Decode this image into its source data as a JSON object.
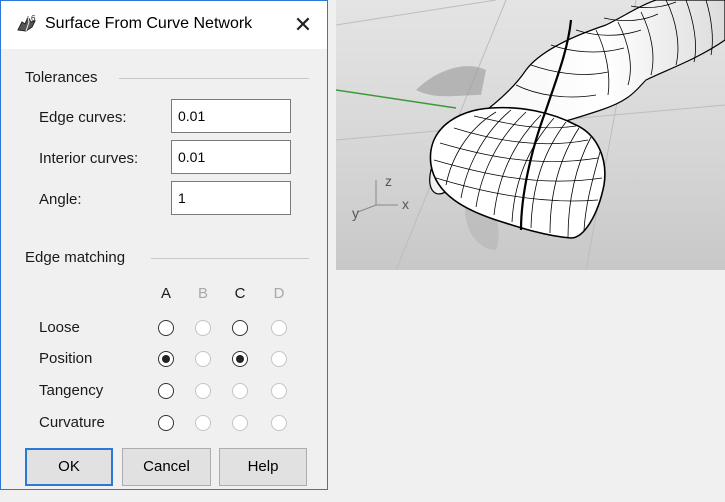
{
  "dialog": {
    "title": "Surface From Curve Network",
    "close_glyph": "✕",
    "app_icon": "rhino-icon",
    "tolerances": {
      "heading": "Tolerances",
      "fields": [
        {
          "label": "Edge curves:",
          "value": "0.01"
        },
        {
          "label": "Interior curves:",
          "value": "0.01"
        },
        {
          "label": "Angle:",
          "value": "1"
        }
      ]
    },
    "edge_matching": {
      "heading": "Edge matching",
      "columns": [
        {
          "label": "A",
          "enabled": true
        },
        {
          "label": "B",
          "enabled": false
        },
        {
          "label": "C",
          "enabled": true
        },
        {
          "label": "D",
          "enabled": false
        }
      ],
      "rows": [
        {
          "label": "Loose",
          "checked": [
            false,
            false,
            false,
            false
          ]
        },
        {
          "label": "Position",
          "checked": [
            true,
            false,
            true,
            false
          ]
        },
        {
          "label": "Tangency",
          "checked": [
            false,
            false,
            false,
            false
          ]
        },
        {
          "label": "Curvature",
          "checked": [
            false,
            false,
            false,
            false
          ]
        }
      ]
    },
    "buttons": {
      "ok": "OK",
      "cancel": "Cancel",
      "help": "Help"
    }
  },
  "viewport": {
    "axis_labels": {
      "z": "z",
      "y": "y",
      "x": "x"
    },
    "colors": {
      "background": "#d2d2d2",
      "x_axis": "#3a9a3a",
      "surface": "#ffffff",
      "curves": "#000000"
    }
  }
}
